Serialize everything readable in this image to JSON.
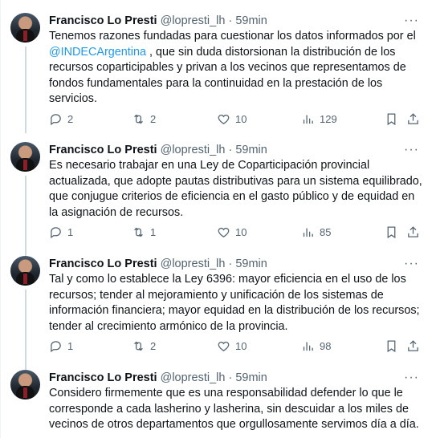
{
  "tweets": [
    {
      "name": "Francisco Lo Presti",
      "handle": "@lopresti_lh",
      "separator": "·",
      "time": "59min",
      "more": "···",
      "text_before": "Tenemos razones fundadas para cuestionar los datos informados por el ",
      "mention": "@INDECArgentina",
      "text_after": " , que sin duda distorsionan la distribución de los recursos coparticipables y privan a los vecinos que representamos de fondos fundamentales para la continuidad en la prestación de los servicios.",
      "replies": "2",
      "retweets": "2",
      "likes": "10",
      "views": "129"
    },
    {
      "name": "Francisco Lo Presti",
      "handle": "@lopresti_lh",
      "separator": "·",
      "time": "59min",
      "more": "···",
      "text": "Es necesario trabajar en una Ley de Coparticipación provincial actualizada, que adopte pautas distributivas para un sistema equilibrado, que conjugue criterios de eficiencia en el gasto público y de equidad en la asignación de recursos.",
      "replies": "1",
      "retweets": "1",
      "likes": "10",
      "views": "85"
    },
    {
      "name": "Francisco Lo Presti",
      "handle": "@lopresti_lh",
      "separator": "·",
      "time": "59min",
      "more": "···",
      "text": "Tal y como lo establece la Ley 6396: mayor eficiencia en el uso de los recursos; tender al mejoramiento y unificación de los sistemas de información financiera; mayor equidad en la distribución de los recursos; tender al crecimiento armónico de la provincia.",
      "replies": "1",
      "retweets": "2",
      "likes": "10",
      "views": "98"
    },
    {
      "name": "Francisco Lo Presti",
      "handle": "@lopresti_lh",
      "separator": "·",
      "time": "59min",
      "more": "···",
      "text": "Considero firmemente que es una responsabilidad defender lo que le corresponde a cada lasherino y lasherina, sin descuidar a los miles de vecinos de otros departamentos que orgullosamente servimos día a día."
    }
  ],
  "icons": {
    "reply": "reply-icon",
    "retweet": "retweet-icon",
    "like": "heart-icon",
    "views": "views-icon",
    "bookmark": "bookmark-icon",
    "share": "share-icon"
  },
  "colors": {
    "link": "#1d9bf0",
    "muted": "#536471",
    "text": "#0f1419"
  }
}
